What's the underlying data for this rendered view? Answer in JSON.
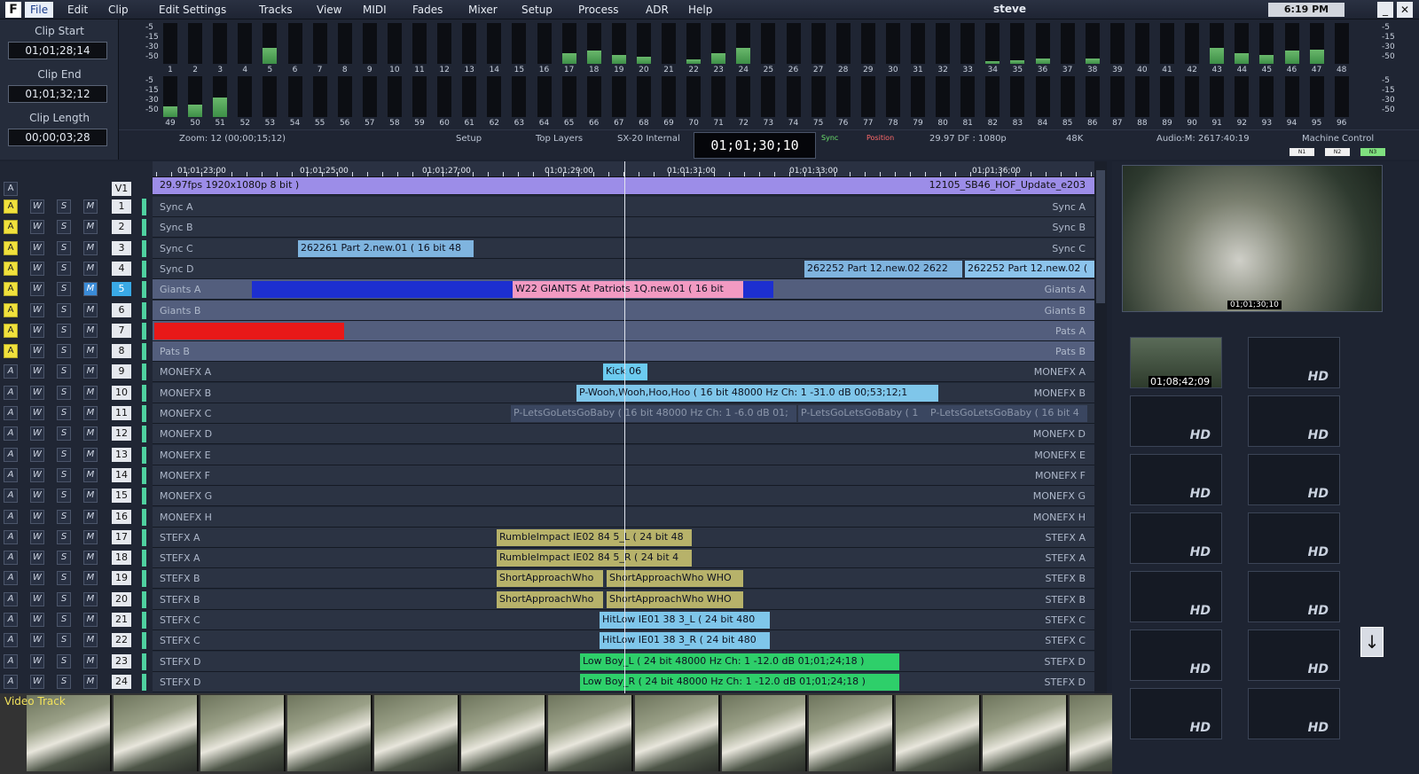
{
  "menu": {
    "items": [
      "File",
      "Edit",
      "Clip",
      "Edit Settings",
      "Tracks",
      "View",
      "MIDI",
      "Fades",
      "Mixer",
      "Setup",
      "Process",
      "ADR",
      "Help"
    ],
    "user": "steve",
    "clock": "6:19 PM"
  },
  "clips": {
    "start_label": "Clip Start",
    "start": "01;01;28;14",
    "end_label": "Clip End",
    "end": "01;01;32;12",
    "length_label": "Clip Length",
    "length": "00;00;03;28"
  },
  "meters": {
    "scale": [
      "-5",
      "-15",
      "-30",
      "-50"
    ],
    "row1": [
      0,
      0,
      0,
      0,
      18,
      0,
      0,
      0,
      0,
      0,
      0,
      0,
      0,
      0,
      0,
      0,
      12,
      15,
      10,
      8,
      0,
      5,
      12,
      18,
      0,
      0,
      0,
      0,
      0,
      0,
      0,
      0,
      0,
      3,
      4,
      6,
      0,
      6,
      0,
      0,
      0,
      0,
      18,
      12,
      10,
      15,
      16,
      0
    ],
    "row2": [
      12,
      14,
      22,
      0,
      0,
      0,
      0,
      0,
      0,
      0,
      0,
      0,
      0,
      0,
      0,
      0,
      0,
      0,
      0,
      0,
      0,
      0,
      0,
      0,
      0,
      0,
      0,
      0,
      0,
      0,
      0,
      0,
      0,
      0,
      0,
      0,
      0,
      0,
      0,
      0,
      0,
      0,
      0,
      0,
      0,
      0,
      0,
      0
    ]
  },
  "status": {
    "zoom": "Zoom: 12 (00;00;15;12)",
    "setup": "Setup",
    "top_layers": "Top Layers",
    "sync_src": "SX-20 Internal",
    "timecode": "01;01;30;10",
    "sync": "Sync",
    "position": "Position",
    "fps": "29.97 DF : 1080p",
    "rate": "48K",
    "audio": "Audio:M: 2617:40:19",
    "machine": "Machine Control",
    "mc_buttons": [
      "N1",
      "N2",
      "N3"
    ]
  },
  "ruler": {
    "labels": [
      "01;01;23;00",
      "01;01;25;00",
      "01;01;27;00",
      "01;01;29;00",
      "01;01;31;00",
      "01;01;33;00",
      "01;01;36;00"
    ]
  },
  "video_track": {
    "name": "V1",
    "info": "29.97fps 1920x1080p 8 bit  )",
    "clip": "12105_SB46_HOF_Update_e203"
  },
  "tracks": [
    {
      "n": "1",
      "name": "Sync A",
      "arm": true
    },
    {
      "n": "2",
      "name": "Sync B",
      "arm": true
    },
    {
      "n": "3",
      "name": "Sync C",
      "arm": true
    },
    {
      "n": "4",
      "name": "Sync D",
      "arm": true
    },
    {
      "n": "5",
      "name": "Giants A",
      "arm": true,
      "sel": true
    },
    {
      "n": "6",
      "name": "Giants B",
      "arm": true
    },
    {
      "n": "7",
      "name": "Pats A",
      "arm": true
    },
    {
      "n": "8",
      "name": "Pats B",
      "arm": true
    },
    {
      "n": "9",
      "name": "MONEFX A"
    },
    {
      "n": "10",
      "name": "MONEFX B"
    },
    {
      "n": "11",
      "name": "MONEFX C"
    },
    {
      "n": "12",
      "name": "MONEFX D"
    },
    {
      "n": "13",
      "name": "MONEFX E"
    },
    {
      "n": "14",
      "name": "MONEFX F"
    },
    {
      "n": "15",
      "name": "MONEFX G"
    },
    {
      "n": "16",
      "name": "MONEFX H"
    },
    {
      "n": "17",
      "name": "STEFX A"
    },
    {
      "n": "18",
      "name": "STEFX A"
    },
    {
      "n": "19",
      "name": "STEFX B"
    },
    {
      "n": "20",
      "name": "STEFX B"
    },
    {
      "n": "21",
      "name": "STEFX C"
    },
    {
      "n": "22",
      "name": "STEFX C"
    },
    {
      "n": "23",
      "name": "STEFX D"
    },
    {
      "n": "24",
      "name": "STEFX D"
    }
  ],
  "track_buttons": {
    "a": "A",
    "w": "W",
    "s": "S",
    "m": "M"
  },
  "clip_items": [
    {
      "lane": 2,
      "text": "262261 Part 2.new.01 (  16 bit 48",
      "color": "#7fb4df"
    },
    {
      "lane": 3,
      "text": "262252 Part 12.new.02  2622",
      "color": "#7fb4df"
    },
    {
      "lane": 3,
      "text": "262252 Part 12.new.02 (",
      "color": "#8cc4ec"
    },
    {
      "lane": 4,
      "text": "",
      "color": "#1d2fd0"
    },
    {
      "lane": 4,
      "text": "W22 GIANTS At Patriots 1Q.new.01 (  16 bit",
      "color": "#f29ac2"
    },
    {
      "lane": 4,
      "text": "",
      "color": "#1d2fd0"
    },
    {
      "lane": 6,
      "text": "",
      "color": "#e81818"
    },
    {
      "lane": 8,
      "text": "Kick 06",
      "color": "#6ccbf0"
    },
    {
      "lane": 9,
      "text": "P-Wooh,Wooh,Hoo,Hoo (  16 bit 48000 Hz Ch: 1  -31.0 dB 00;53;12;1",
      "color": "#7fc6ea"
    },
    {
      "lane": 10,
      "text": "P-LetsGoLetsGoBaby (  16 bit 48000 Hz Ch: 1  -6.0 dB 01;",
      "color": "#3a4660"
    },
    {
      "lane": 10,
      "text": "P-LetsGoLetsGoBaby (  1",
      "color": "#3a4660"
    },
    {
      "lane": 10,
      "text": "P-LetsGoLetsGoBaby (  16 bit 4",
      "color": "#3a4660"
    },
    {
      "lane": 16,
      "text": "RumbleImpact IE02 84 5_L (  24 bit 48",
      "color": "#b7b26a"
    },
    {
      "lane": 17,
      "text": "RumbleImpact IE02 84 5_R (  24 bit 4",
      "color": "#b7b26a"
    },
    {
      "lane": 18,
      "text": "ShortApproachWho",
      "color": "#b7b26a"
    },
    {
      "lane": 18,
      "text": "ShortApproachWho WHO",
      "color": "#b7b26a"
    },
    {
      "lane": 19,
      "text": "ShortApproachWho",
      "color": "#b7b26a"
    },
    {
      "lane": 19,
      "text": "ShortApproachWho WHO",
      "color": "#b7b26a"
    },
    {
      "lane": 20,
      "text": "HitLow IE01 38 3_L (  24 bit 480",
      "color": "#7fc6ea"
    },
    {
      "lane": 21,
      "text": "HitLow IE01 38 3_R (  24 bit 480",
      "color": "#7fc6ea"
    },
    {
      "lane": 22,
      "text": "Low Boy_L (  24 bit 48000 Hz Ch: 1  -12.0 dB 01;01;24;18 )",
      "color": "#2ecf6a"
    },
    {
      "lane": 23,
      "text": "Low Boy_R (  24 bit 48000 Hz Ch: 1  -12.0 dB 01;01;24;18 )",
      "color": "#2ecf6a"
    }
  ],
  "video_strip": {
    "label": "Video Track"
  },
  "preview": {
    "timecode": "01;01;30;10"
  },
  "bins": {
    "thumb_tc": "01;08;42;09",
    "label": "HD"
  }
}
